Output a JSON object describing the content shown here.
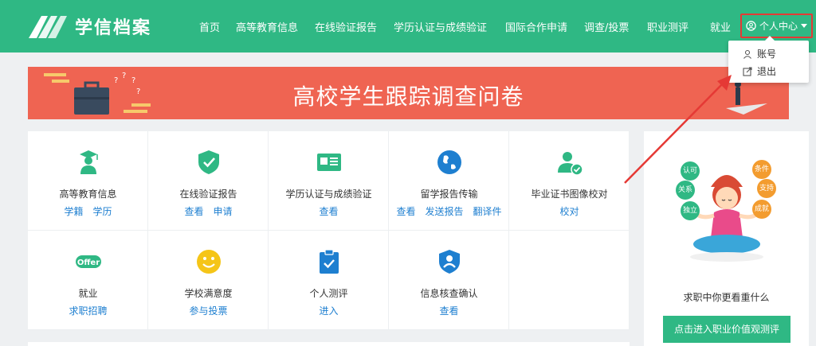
{
  "header": {
    "logo_text": "学信档案",
    "nav": [
      {
        "label": "首页"
      },
      {
        "label": "高等教育信息"
      },
      {
        "label": "在线验证报告"
      },
      {
        "label": "学历认证与成绩验证"
      },
      {
        "label": "国际合作申请"
      },
      {
        "label": "调查/投票"
      },
      {
        "label": "职业测评"
      },
      {
        "label": "就业"
      }
    ],
    "user_menu_label": "个人中心",
    "dropdown": {
      "account": "账号",
      "logout": "退出"
    }
  },
  "banner": {
    "title": "高校学生跟踪调查问卷"
  },
  "services": [
    {
      "title": "高等教育信息",
      "links": [
        "学籍",
        "学历"
      ],
      "icon": "graduate-icon"
    },
    {
      "title": "在线验证报告",
      "links": [
        "查看",
        "申请"
      ],
      "icon": "shield-check-icon"
    },
    {
      "title": "学历认证与成绩验证",
      "links": [
        "查看"
      ],
      "icon": "id-card-icon"
    },
    {
      "title": "留学报告传输",
      "links": [
        "查看",
        "发送报告",
        "翻译件"
      ],
      "icon": "globe-icon"
    },
    {
      "title": "毕业证书图像校对",
      "links": [
        "校对"
      ],
      "icon": "user-check-icon"
    },
    {
      "title": "就业",
      "links": [
        "求职招聘"
      ],
      "icon": "offer-icon",
      "icon_text": "Offer"
    },
    {
      "title": "学校满意度",
      "links": [
        "参与投票"
      ],
      "icon": "smiley-icon"
    },
    {
      "title": "个人测评",
      "links": [
        "进入"
      ],
      "icon": "clipboard-check-icon"
    },
    {
      "title": "信息核查确认",
      "links": [
        "查看"
      ],
      "icon": "user-shield-icon"
    }
  ],
  "side_panel": {
    "bubbles": [
      "认可",
      "关系",
      "独立",
      "条件",
      "支持",
      "成就"
    ],
    "caption": "求职中你更看重什么",
    "button": "点击进入职业价值观测评"
  },
  "colors": {
    "brand": "#2fb884",
    "banner": "#ef6452",
    "link": "#1e7fd0",
    "highlight": "#e53935"
  }
}
